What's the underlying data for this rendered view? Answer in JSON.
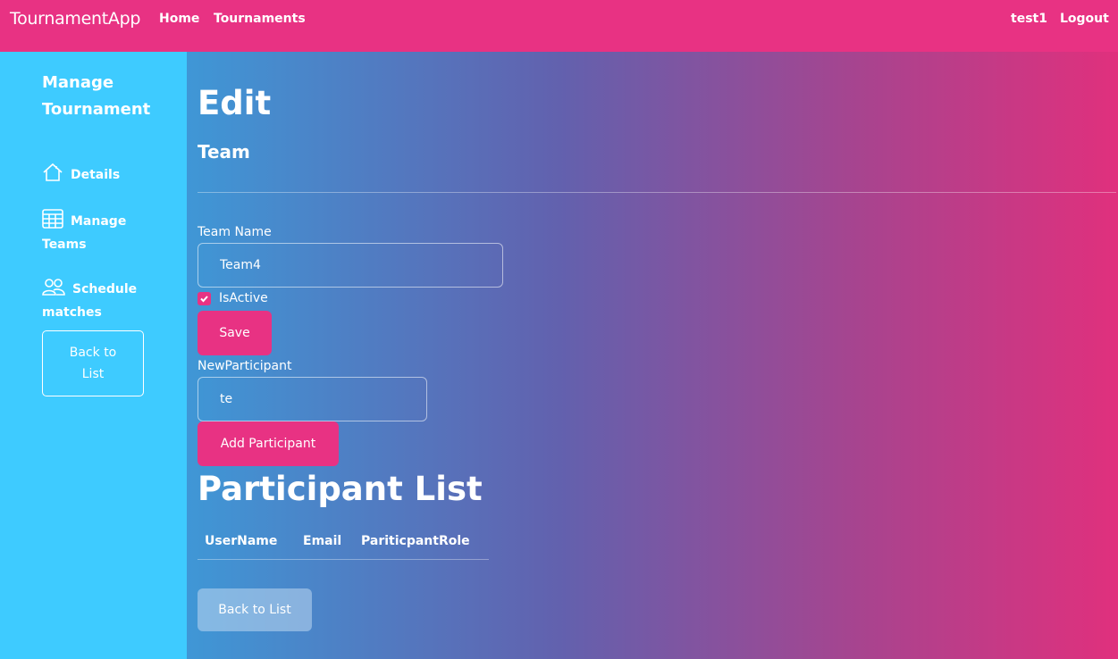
{
  "navbar": {
    "brand": "TournamentApp",
    "links": {
      "home": "Home",
      "tournaments": "Tournaments"
    },
    "user": "test1",
    "logout": "Logout",
    "color": "#e83283"
  },
  "sidebar": {
    "title": "Manage Tournament",
    "items": [
      {
        "label": "Details",
        "icon": "home-icon"
      },
      {
        "label": "Manage Teams",
        "icon": "table-icon"
      },
      {
        "label": "Schedule matches",
        "icon": "people-icon"
      }
    ],
    "back_label": "Back to List",
    "color": "#3ecbff"
  },
  "main": {
    "heading": "Edit",
    "subheading": "Team",
    "form": {
      "team_name_label": "Team Name",
      "team_name_value": "Team4",
      "is_active_label": "IsActive",
      "is_active_checked": true,
      "save_label": "Save",
      "new_participant_label": "NewParticipant",
      "new_participant_value": "te",
      "add_participant_label": "Add Participant"
    },
    "participant_list": {
      "heading": "Participant List",
      "columns": [
        "UserName",
        "Email",
        "PariticpantRole"
      ],
      "rows": []
    },
    "back_label": "Back to List"
  }
}
